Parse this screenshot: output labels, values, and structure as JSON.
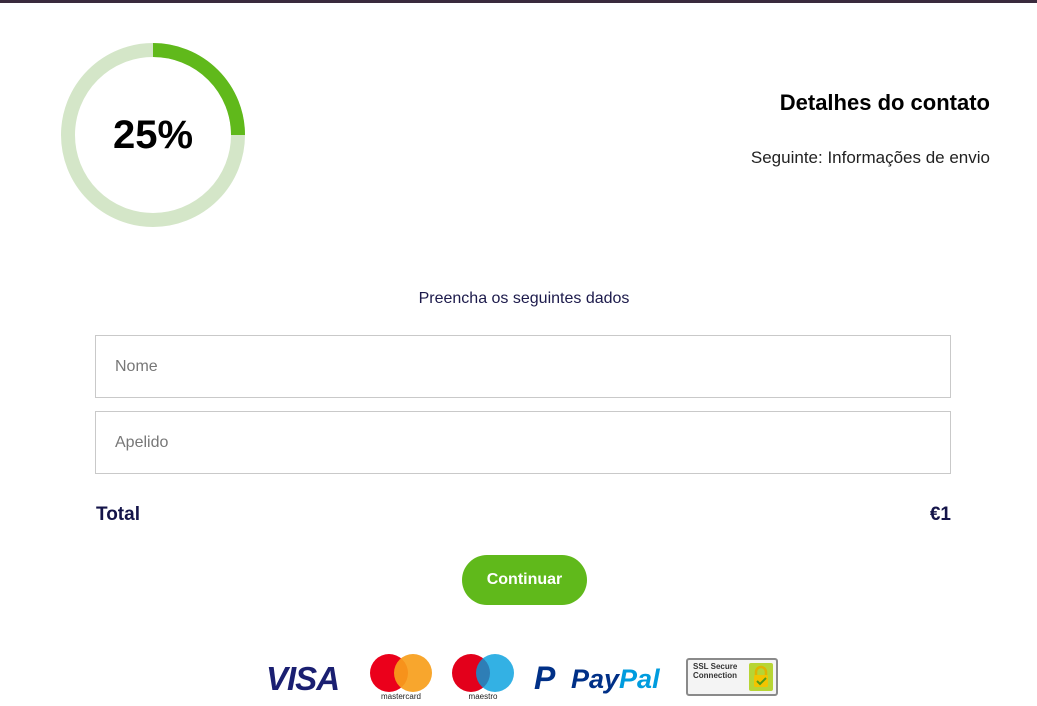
{
  "progress": {
    "percent": 25,
    "label": "25%"
  },
  "step": {
    "title": "Detalhes do contato",
    "next": "Seguinte: Informações de envio"
  },
  "form": {
    "instruction": "Preencha os seguintes dados",
    "fields": [
      {
        "placeholder": "Nome",
        "value": ""
      },
      {
        "placeholder": "Apelido",
        "value": ""
      }
    ]
  },
  "summary": {
    "total_label": "Total",
    "total_value": "€1"
  },
  "actions": {
    "continue_label": "Continuar"
  },
  "payments": {
    "visa": "VISA",
    "mastercard": "mastercard",
    "maestro": "maestro",
    "paypal_mark": "P",
    "paypal_pay": "Pay",
    "paypal_pal": "Pal",
    "ssl": "SSL Secure Connection"
  },
  "colors": {
    "accent": "#60b91b",
    "progress_track": "#d4e6c8",
    "heading": "#141449",
    "topbar": "#3a2a3d"
  },
  "icons": [
    "visa-logo",
    "mastercard-logo",
    "maestro-logo",
    "paypal-logo",
    "ssl-badge",
    "lock-icon"
  ]
}
